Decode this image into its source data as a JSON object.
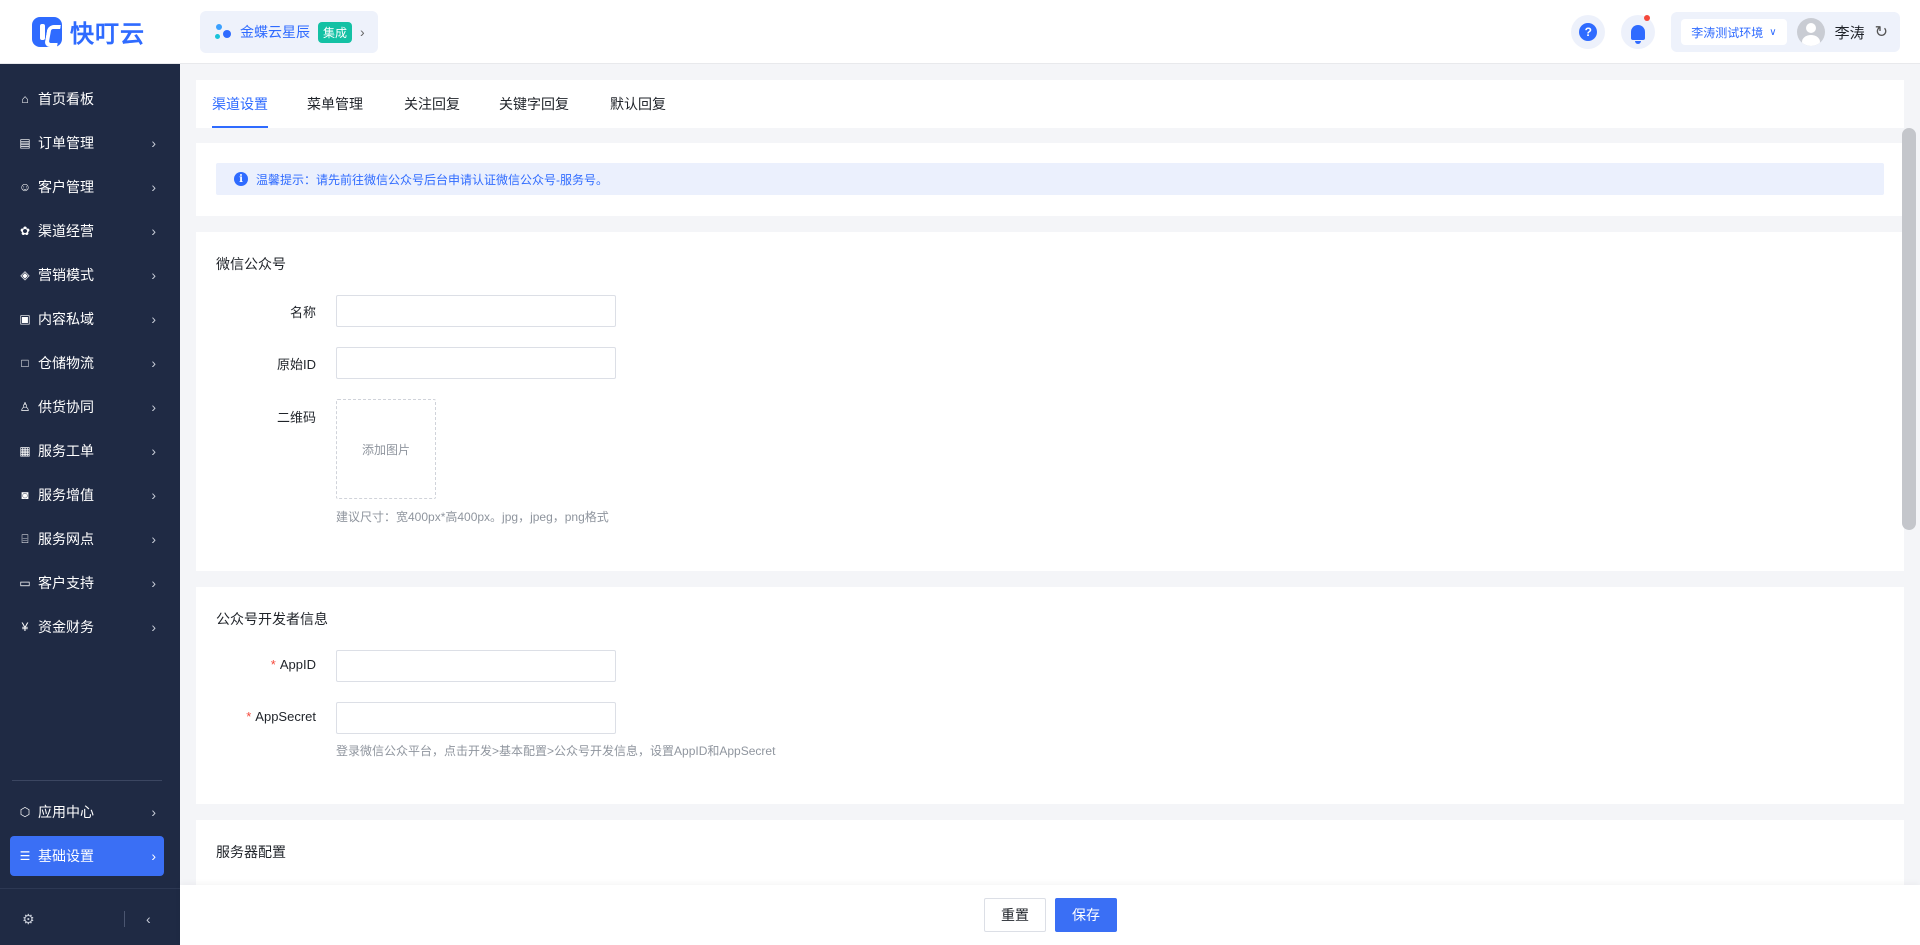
{
  "logo": {
    "text": "快叮云"
  },
  "brand": {
    "name": "金蝶云星辰",
    "tag": "集成"
  },
  "header": {
    "help_glyph": "?",
    "env": "李涛测试环境",
    "user": "李涛"
  },
  "sidebar": {
    "items": [
      {
        "label": "首页看板",
        "icon": "home-icon"
      },
      {
        "label": "订单管理",
        "icon": "clipboard-icon"
      },
      {
        "label": "客户管理",
        "icon": "user-icon"
      },
      {
        "label": "渠道经营",
        "icon": "channel-icon"
      },
      {
        "label": "营销模式",
        "icon": "tag-icon"
      },
      {
        "label": "内容私域",
        "icon": "image-icon"
      },
      {
        "label": "仓储物流",
        "icon": "box-icon"
      },
      {
        "label": "供货协同",
        "icon": "supply-icon"
      },
      {
        "label": "服务工单",
        "icon": "ticket-icon"
      },
      {
        "label": "服务增值",
        "icon": "bag-icon"
      },
      {
        "label": "服务网点",
        "icon": "store-icon"
      },
      {
        "label": "客户支持",
        "icon": "support-icon"
      },
      {
        "label": "资金财务",
        "icon": "yuan-icon"
      }
    ],
    "bottom_items": [
      {
        "label": "应用中心",
        "icon": "cube-icon"
      },
      {
        "label": "基础设置",
        "icon": "sliders-icon"
      }
    ]
  },
  "tabs": [
    {
      "label": "渠道设置",
      "active": true
    },
    {
      "label": "菜单管理"
    },
    {
      "label": "关注回复"
    },
    {
      "label": "关键字回复"
    },
    {
      "label": "默认回复"
    }
  ],
  "tip": {
    "text": "温馨提示：请先前往微信公众号后台申请认证微信公众号-服务号。"
  },
  "wechat": {
    "title": "微信公众号",
    "name_label": "名称",
    "origin_id_label": "原始ID",
    "qrcode_label": "二维码",
    "upload_text": "添加图片",
    "upload_hint": "建议尺寸：宽400px*高400px。jpg，jpeg，png格式"
  },
  "developer": {
    "title": "公众号开发者信息",
    "required_mark": "*",
    "appid_label": "AppID",
    "appsecret_label": "AppSecret",
    "hint": "登录微信公众平台，点击开发>基本配置>公众号开发信息，设置AppID和AppSecret"
  },
  "server": {
    "title": "服务器配置"
  },
  "footer": {
    "reset": "重置",
    "save": "保存"
  },
  "colors": {
    "accent": "#2f6bff",
    "sidebar_bg": "#1f2a44",
    "active_nav": "#3a6ff5",
    "tag_green": "#14c1a4"
  }
}
